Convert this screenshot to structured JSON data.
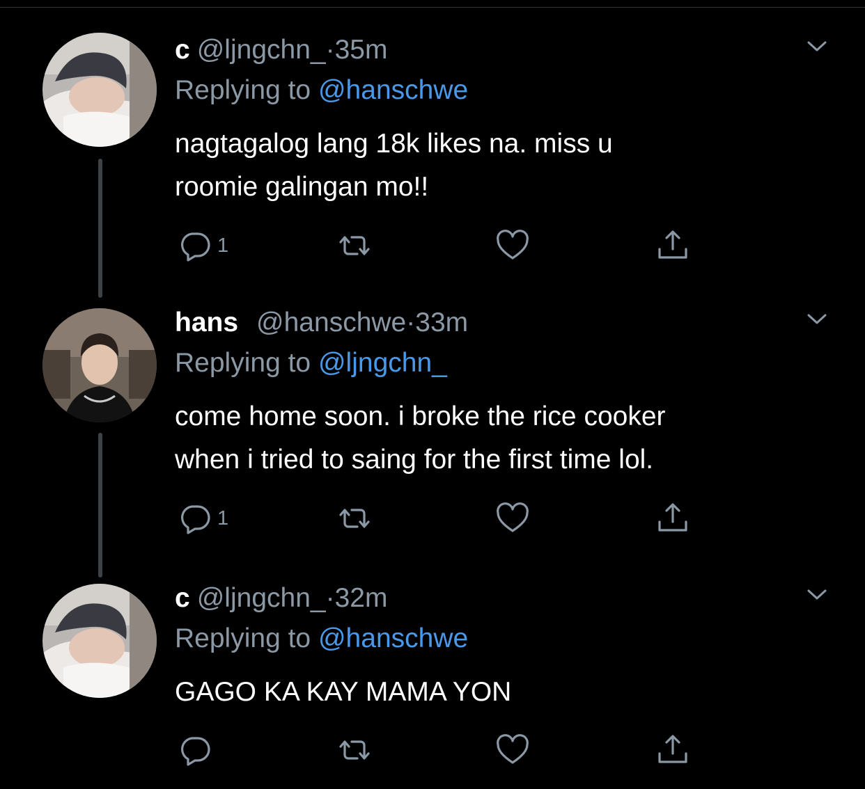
{
  "tweets": [
    {
      "display_name": "c",
      "handle": "@ljngchn_",
      "separator": "·",
      "time": "35m",
      "reply_prefix": "Replying to",
      "reply_to": "@hanschwe",
      "body_lines": [
        "nagtagalog lang 18k likes na. miss u",
        "roomie galingan mo!!"
      ],
      "reply_count": "1"
    },
    {
      "display_name": "hans",
      "handle": "@hanschwe",
      "separator": "·",
      "time": "33m",
      "reply_prefix": "Replying to",
      "reply_to": "@ljngchn_",
      "body_lines": [
        "come home soon. i broke the rice cooker",
        "when i tried to saing for the first time lol."
      ],
      "reply_count": "1"
    },
    {
      "display_name": "c",
      "handle": "@ljngchn_",
      "separator": "·",
      "time": "32m",
      "reply_prefix": "Replying to",
      "reply_to": "@hanschwe",
      "body_lines": [
        "GAGO KA KAY MAMA YON"
      ],
      "reply_count": ""
    }
  ],
  "icons": {
    "reply": "reply-icon",
    "retweet": "retweet-icon",
    "like": "heart-icon",
    "share": "share-icon",
    "more": "chevron-down-icon"
  },
  "colors": {
    "background": "#000000",
    "text": "#ffffff",
    "secondary": "#8b98a5",
    "link": "#4a99e9",
    "thread_line": "#3d4246"
  }
}
